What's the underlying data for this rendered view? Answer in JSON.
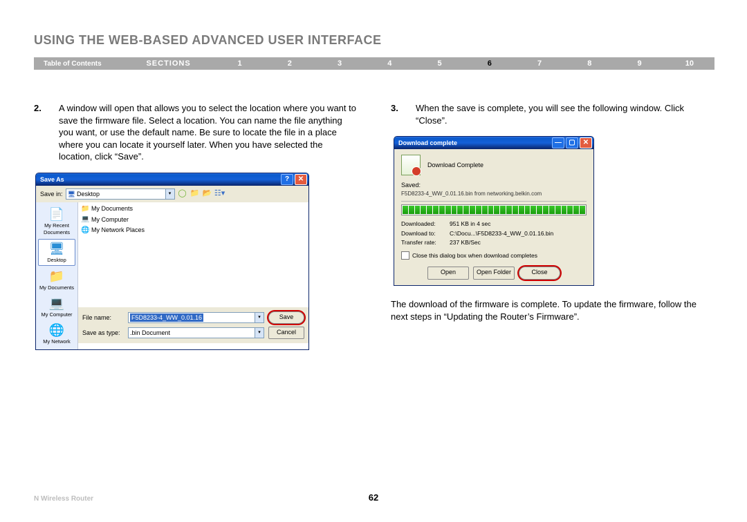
{
  "pageTitle": "USING THE WEB-BASED ADVANCED USER INTERFACE",
  "toc": "Table of Contents",
  "sectionsLabel": "SECTIONS",
  "sectionNums": [
    "1",
    "2",
    "3",
    "4",
    "5",
    "6",
    "7",
    "8",
    "9",
    "10"
  ],
  "activeSection": "6",
  "step2": {
    "num": "2.",
    "text": "A window will open that allows you to select the location where you want to save the firmware file. Select a location. You can name the file anything you want, or use the default name. Be sure to locate the file in a place where you can locate it yourself later. When you have selected the location, click “Save”."
  },
  "step3": {
    "num": "3.",
    "text": "When the save is complete, you will see the following window. Click “Close”."
  },
  "afterDlText": "The download of the firmware is complete. To update the firmware, follow the next steps in “Updating the Router’s Firmware”.",
  "footerProduct": "N Wireless Router",
  "pageNum": "62",
  "saveAs": {
    "title": "Save As",
    "saveInLabel": "Save in:",
    "saveIn": "Desktop",
    "sidebar": [
      "My Recent Documents",
      "Desktop",
      "My Documents",
      "My Computer",
      "My Network"
    ],
    "files": [
      "My Documents",
      "My Computer",
      "My Network Places"
    ],
    "fileNameLabel": "File name:",
    "fileName": "F5D8233-4_WW_0.01.16",
    "saveTypeLabel": "Save as type:",
    "saveType": ".bin Document",
    "save": "Save",
    "cancel": "Cancel"
  },
  "dl": {
    "title": "Download complete",
    "complete": "Download Complete",
    "saved": "Saved:",
    "path": "F5D8233-4_WW_0.01.16.bin from networking.belkin.com",
    "rows": {
      "downloaded_k": "Downloaded:",
      "downloaded_v": "951 KB in 4 sec",
      "downloadto_k": "Download to:",
      "downloadto_v": "C:\\Docu...\\F5D8233-4_WW_0.01.16.bin",
      "rate_k": "Transfer rate:",
      "rate_v": "237 KB/Sec"
    },
    "checkboxLabel": "Close this dialog box when download completes",
    "open": "Open",
    "openFolder": "Open Folder",
    "close": "Close"
  }
}
